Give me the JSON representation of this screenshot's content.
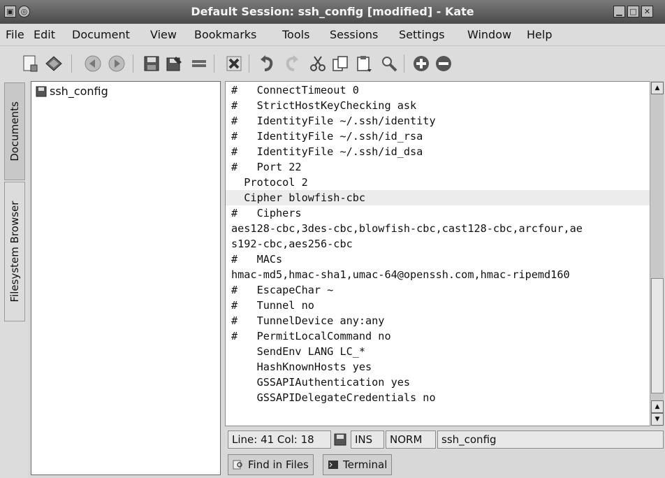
{
  "window": {
    "title": "Default Session: ssh_config [modified] - Kate"
  },
  "menubar": {
    "items": [
      "File",
      "Edit",
      "Document",
      "View",
      "Bookmarks",
      "Tools",
      "Sessions",
      "Settings",
      "Window",
      "Help"
    ]
  },
  "toolbar": {
    "icons": [
      "new-document-icon",
      "open-document-icon",
      "back-icon",
      "forward-icon",
      "save-icon",
      "save-as-icon",
      "print-icon",
      "close-document-icon",
      "undo-icon",
      "redo-icon",
      "cut-icon",
      "copy-icon",
      "paste-icon",
      "find-icon",
      "zoom-in-icon",
      "zoom-out-icon"
    ]
  },
  "sidetabs": {
    "documents": "Documents",
    "filesystem": "Filesystem Browser"
  },
  "documents": {
    "items": [
      "ssh_config"
    ]
  },
  "editor": {
    "lines": [
      "#   ConnectTimeout 0",
      "#   StrictHostKeyChecking ask",
      "#   IdentityFile ~/.ssh/identity",
      "#   IdentityFile ~/.ssh/id_rsa",
      "#   IdentityFile ~/.ssh/id_dsa",
      "#   Port 22",
      "  Protocol 2",
      "  Cipher blowfish-cbc",
      "#   Ciphers",
      "aes128-cbc,3des-cbc,blowfish-cbc,cast128-cbc,arcfour,ae",
      "s192-cbc,aes256-cbc",
      "#   MACs",
      "hmac-md5,hmac-sha1,umac-64@openssh.com,hmac-ripemd160",
      "#   EscapeChar ~",
      "#   Tunnel no",
      "#   TunnelDevice any:any",
      "#   PermitLocalCommand no",
      "    SendEnv LANG LC_*",
      "    HashKnownHosts yes",
      "    GSSAPIAuthentication yes",
      "    GSSAPIDelegateCredentials no"
    ],
    "highlighted_line": 7
  },
  "statusbar": {
    "position": "Line: 41 Col: 18",
    "insert_mode": "INS",
    "selection_mode": "NORM",
    "filename": "ssh_config"
  },
  "bottomtabs": {
    "find": "Find in Files",
    "terminal": "Terminal"
  }
}
